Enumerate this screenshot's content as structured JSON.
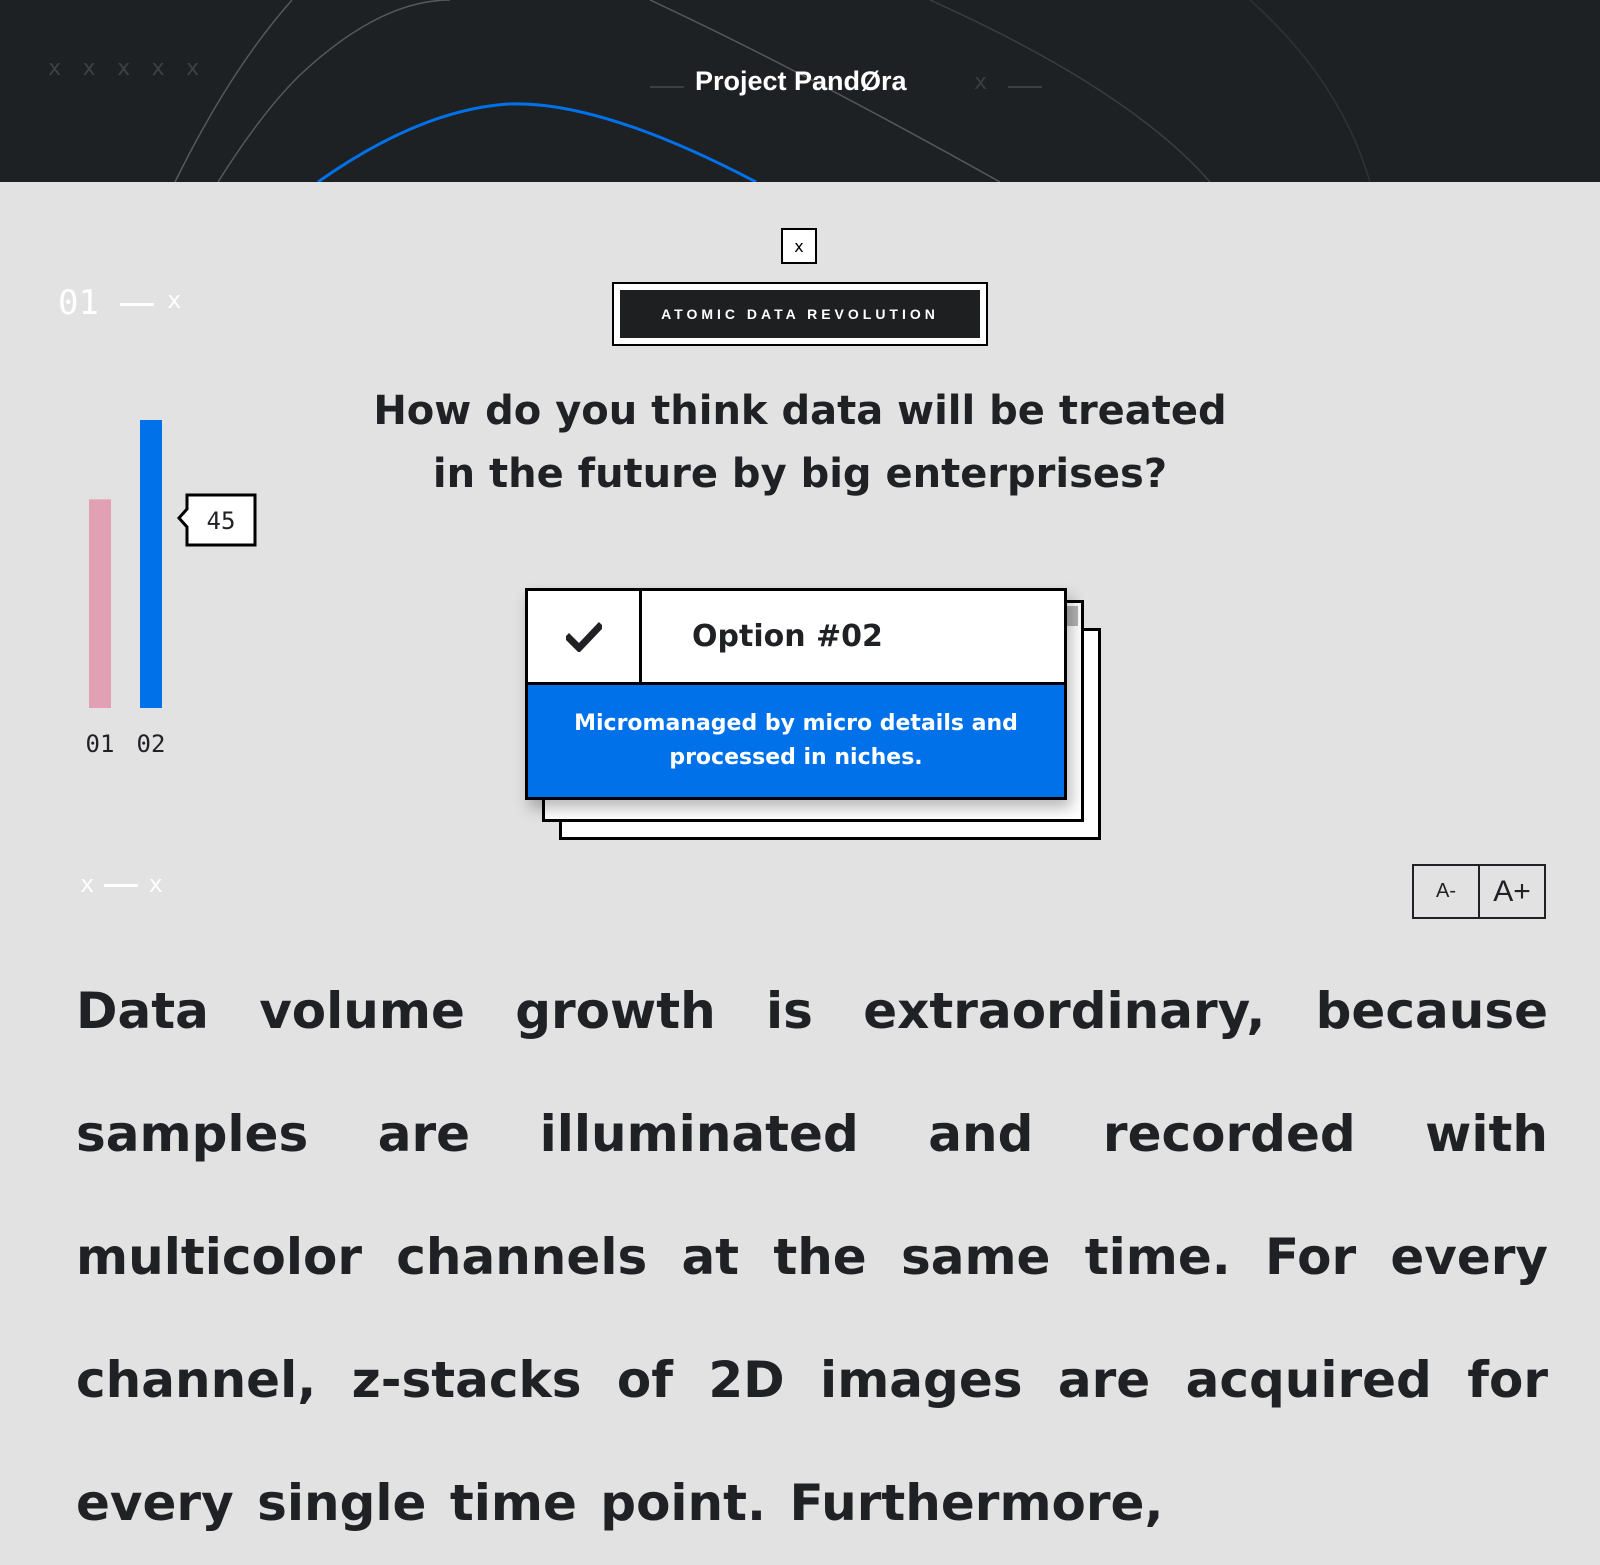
{
  "header": {
    "marks": "x x x x x",
    "brand": "Project PandØra",
    "brand_mark": "x"
  },
  "close_label": "x",
  "tag_label": "ATOMIC DATA REVOLUTION",
  "step": {
    "number": "01",
    "mark": "x"
  },
  "footer_marks": {
    "left": "x",
    "right": "x"
  },
  "question": {
    "line1": "How do you think data will be treated",
    "line2": "in the future by big enterprises?"
  },
  "option": {
    "label": "Option #02",
    "description": "Micromanaged by micro details and processed in niches.",
    "selected": true
  },
  "font_controls": {
    "decrease": "A-",
    "increase": "A+"
  },
  "body_text": "Data volume growth is extraordinary, because samples are illuminated and recorded with multicolor channels at the same time. For every channel, z-stacks of 2D images are acquired for every single time point. Furthermore,",
  "colors": {
    "accent_blue": "#0071e9",
    "pink": "#e1a0b4",
    "dark": "#1e2124",
    "background": "#e2e2e2"
  },
  "chart_data": {
    "type": "bar",
    "categories": [
      "01",
      "02"
    ],
    "values": [
      32.6,
      45
    ],
    "data_label": "45",
    "ylim": [
      0,
      45
    ],
    "colors": [
      "#e1a0b4",
      "#0071e9"
    ]
  }
}
